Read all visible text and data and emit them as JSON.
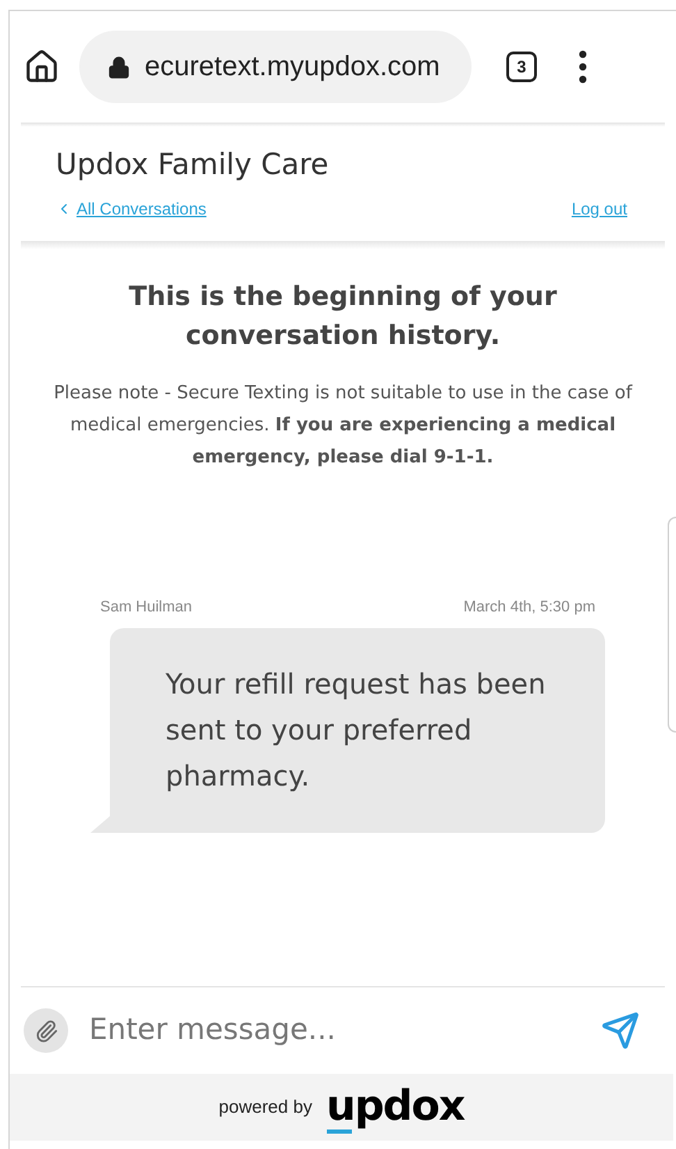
{
  "browser": {
    "url": "ecuretext.myupdox.com",
    "tab_count": "3"
  },
  "header": {
    "title": "Updox Family Care",
    "back_link": "All Conversations",
    "logout_link": "Log out"
  },
  "intro": {
    "heading": "This is the beginning of your conversation history.",
    "note": "Please note - Secure Texting is not suitable to use in the case of medical emergencies. **If you are experiencing a medical emergency, please dial 9-1-1.**"
  },
  "messages": [
    {
      "sender": "Sam Huilman",
      "time": "March 4th, 5:30 pm",
      "text": "Your refill request has been sent to your preferred pharmacy."
    }
  ],
  "composer": {
    "placeholder": "Enter message..."
  },
  "footer": {
    "powered_by": "powered by",
    "logo": "updox"
  }
}
